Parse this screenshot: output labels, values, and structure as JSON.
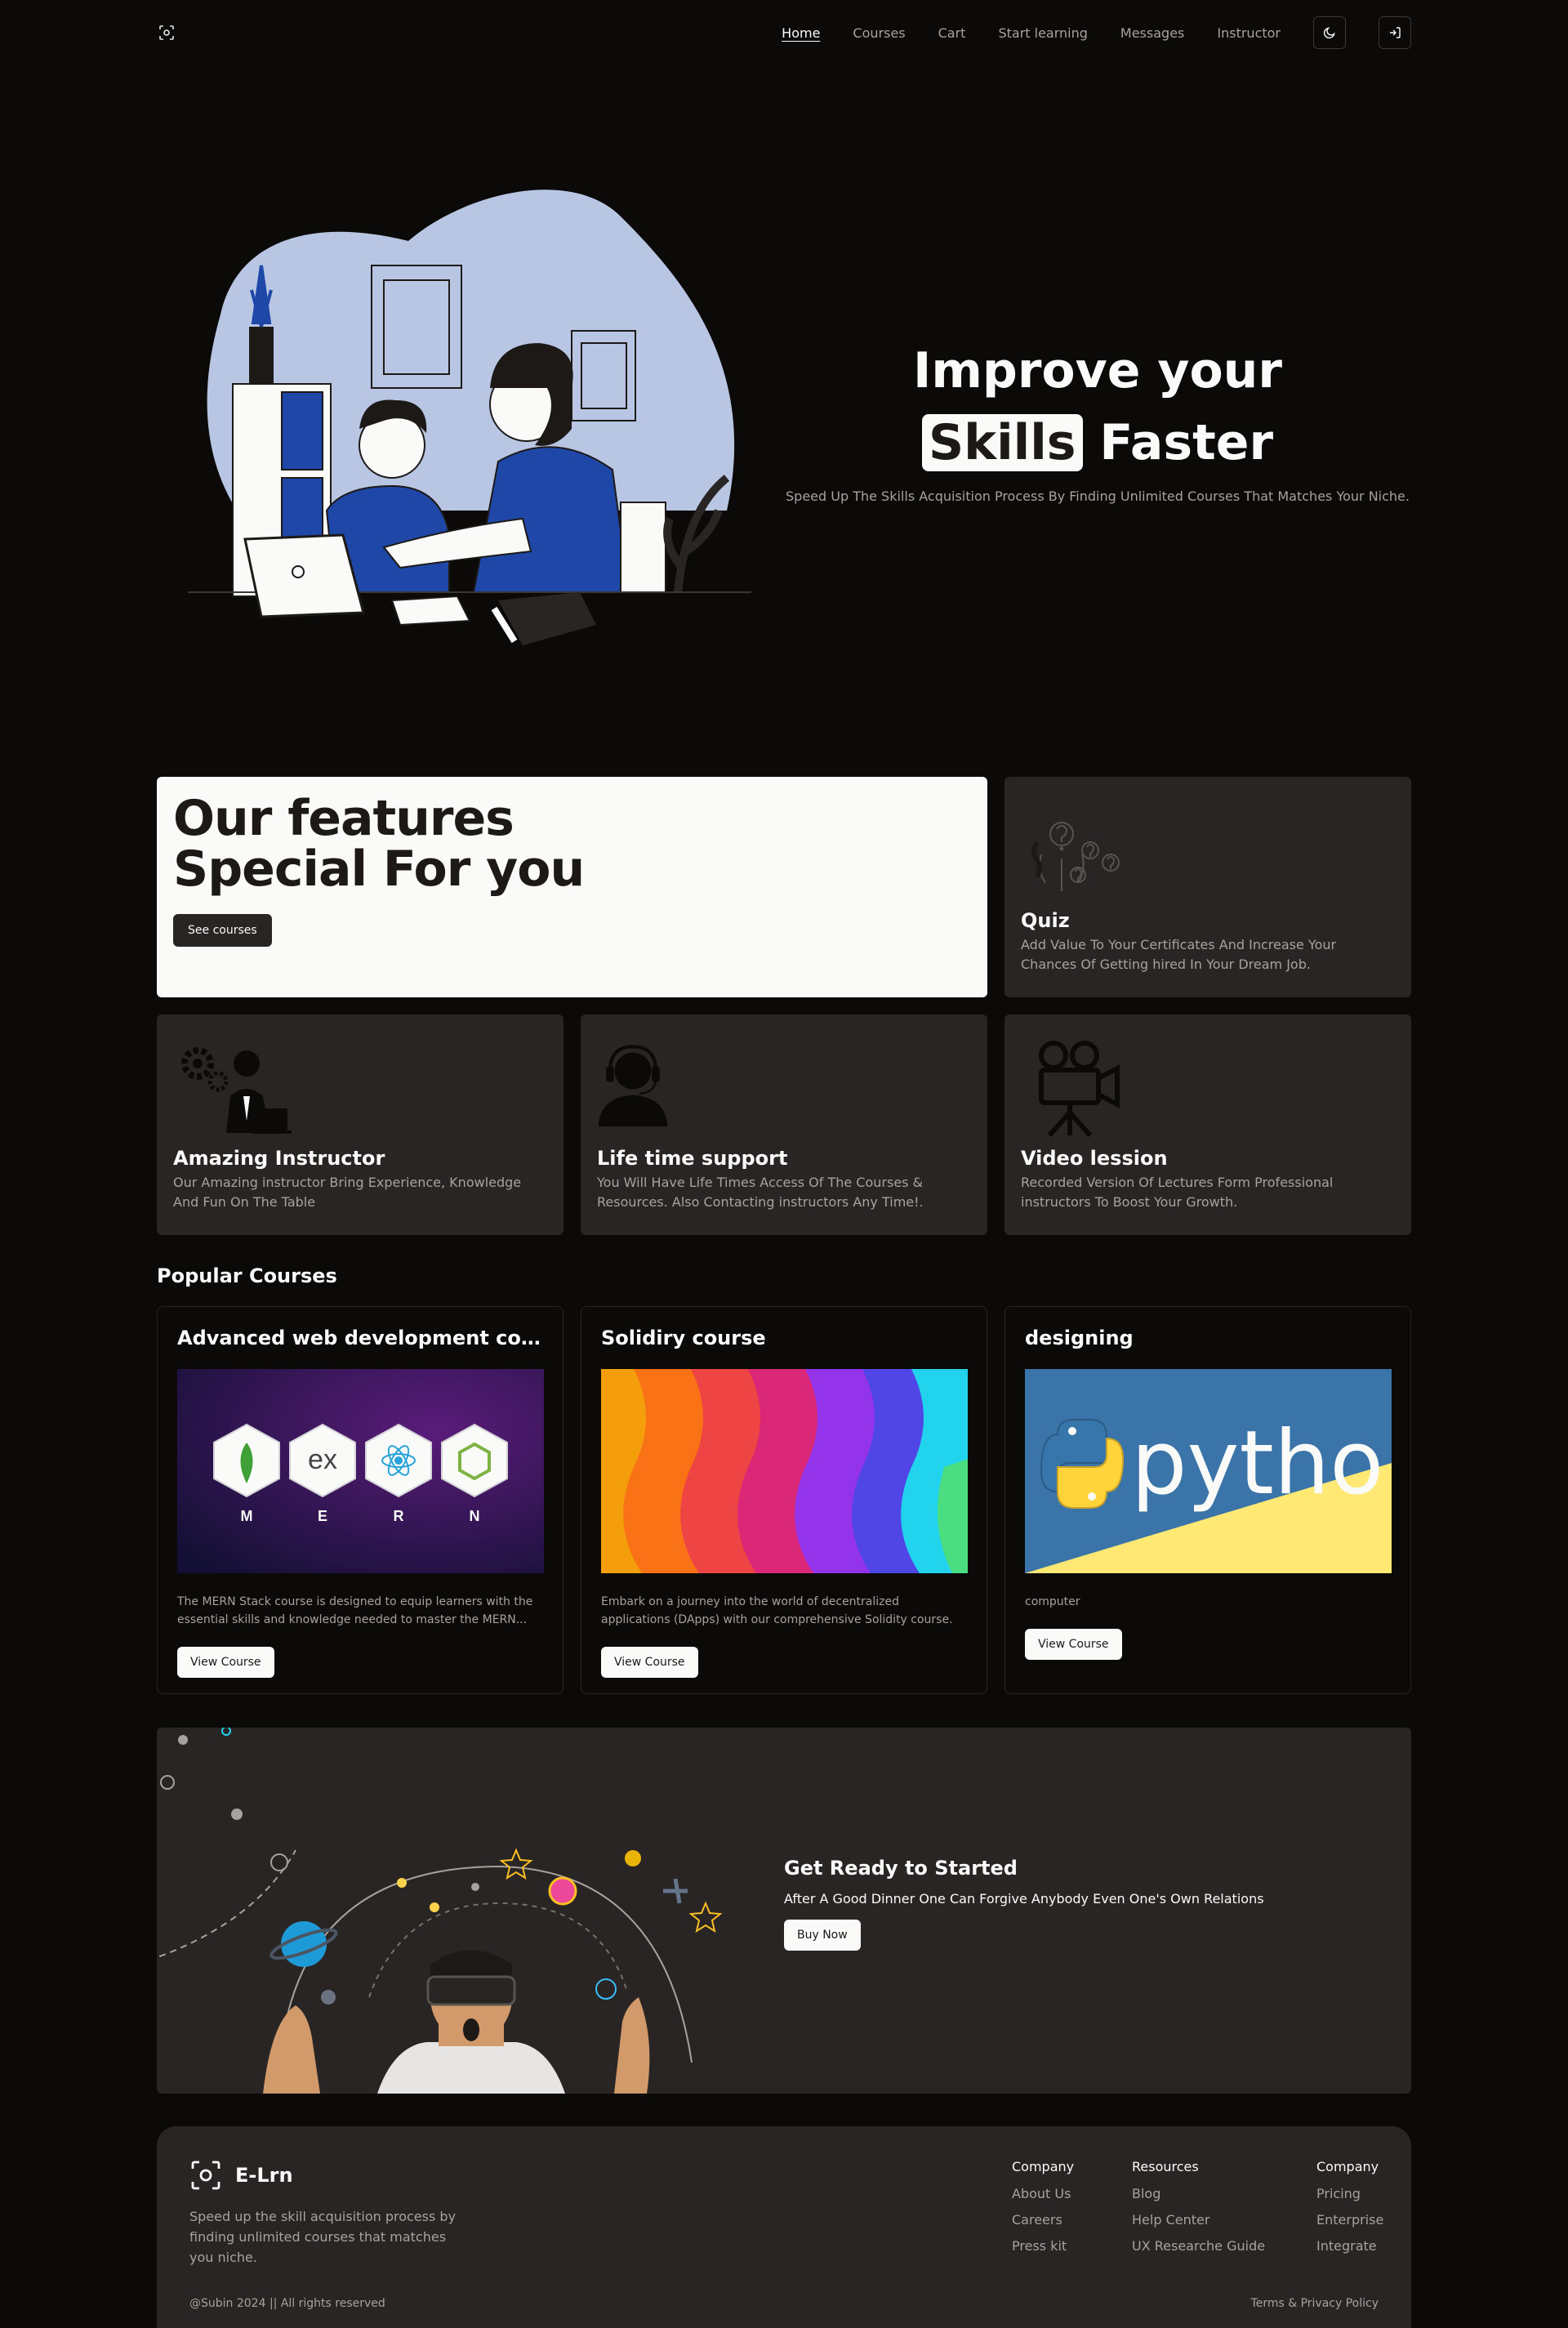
{
  "nav": {
    "links": [
      "Home",
      "Courses",
      "Cart",
      "Start learning",
      "Messages",
      "Instructor"
    ]
  },
  "hero": {
    "title_line1": "Improve your",
    "title_highlight": "Skills",
    "title_rest": "Faster",
    "subtitle": "Speed Up The Skills Acquisition Process By Finding Unlimited Courses That Matches Your Niche."
  },
  "features": {
    "headline_line1": "Our features",
    "headline_line2": "Special For you",
    "cta": "See courses",
    "cards": [
      {
        "title": "Quiz",
        "desc": "Add Value To Your Certificates And Increase Your Chances Of Getting hired In Your Dream Job."
      },
      {
        "title": "Amazing Instructor",
        "desc": "Our Amazing instructor Bring Experience, Knowledge And Fun On The Table"
      },
      {
        "title": "Life time support",
        "desc": "You Will Have Life Times Access Of The Courses & Resources. Also Contacting instructors Any Time!."
      },
      {
        "title": "Video lession",
        "desc": "Recorded Version Of Lectures Form Professional instructors To Boost Your Growth."
      }
    ]
  },
  "popular": {
    "title": "Popular Courses",
    "courses": [
      {
        "title": "Advanced web development course Me...",
        "desc": "The MERN Stack course is designed to equip learners with the essential skills and knowledge needed to master the MERN...",
        "button": "View Course",
        "thumb_letters": [
          "M",
          "E",
          "R",
          "N"
        ],
        "thumb_ex": "ex"
      },
      {
        "title": "Solidiry course",
        "desc": "Embark on a journey into the world of decentralized applications (DApps) with our comprehensive Solidity course. Designed for both...",
        "button": "View Course"
      },
      {
        "title": "designing",
        "desc": "computer",
        "button": "View Course",
        "thumb_word": "python"
      }
    ]
  },
  "cta": {
    "title": "Get Ready to Started",
    "subtitle": "After A Good Dinner One Can Forgive Anybody Even One's Own Relations",
    "button": "Buy Now"
  },
  "footer": {
    "brand": "E-Lrn",
    "desc": "Speed up the skill acquisition process by finding unlimited courses that matches you niche.",
    "col1": {
      "heading": "Company",
      "links": [
        "About Us",
        "Careers",
        "Press kit"
      ]
    },
    "col2": {
      "heading": "Resources",
      "links": [
        "Blog",
        "Help Center",
        "UX Researche Guide"
      ]
    },
    "col3": {
      "heading": "Company",
      "links": [
        "Pricing",
        "Enterprise",
        "Integrate"
      ]
    },
    "copyright": "@Subin 2024 || All rights reserved",
    "terms": "Terms & Privacy Policy"
  },
  "colors": {
    "bg": "#0b0a09",
    "card": "#292524",
    "light": "#fafaf9",
    "muted": "#a8a29e",
    "illus_blue": "#1f47a8",
    "illus_bg": "#b8c6e3"
  }
}
